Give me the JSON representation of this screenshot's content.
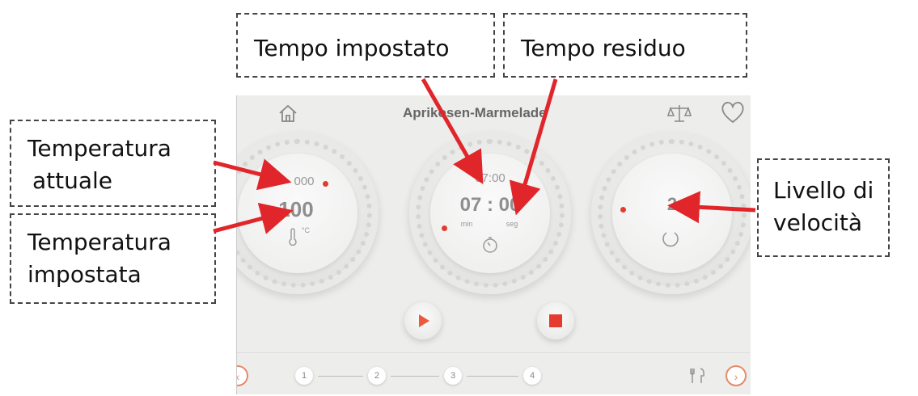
{
  "annotations": {
    "set_time": "Tempo impostato",
    "remaining_time": "Tempo residuo",
    "current_temp_line1": "Temperatura",
    "current_temp_line2": "attuale",
    "set_temp_line1": "Temperatura",
    "set_temp_line2": "impostata",
    "speed_line1": "Livello di",
    "speed_line2": "velocità"
  },
  "screen": {
    "title": "Aprikosen-Marmelade",
    "temperature": {
      "current": "000",
      "set": "100",
      "unit": "°C"
    },
    "timer": {
      "set": "07:00",
      "remaining": "07 : 00",
      "min_label": "min",
      "sec_label": "seg"
    },
    "speed": {
      "level": "2"
    },
    "steps": [
      "1",
      "2",
      "3",
      "4"
    ],
    "icons": {
      "home": "home-icon",
      "scale": "scale-icon",
      "favorite": "heart-icon",
      "thermometer": "thermometer-icon",
      "timer": "timer-icon",
      "rotation": "rotation-icon",
      "play": "play-icon",
      "stop": "stop-icon",
      "utensils": "utensils-icon"
    },
    "accent_color": "#e53b2e"
  }
}
